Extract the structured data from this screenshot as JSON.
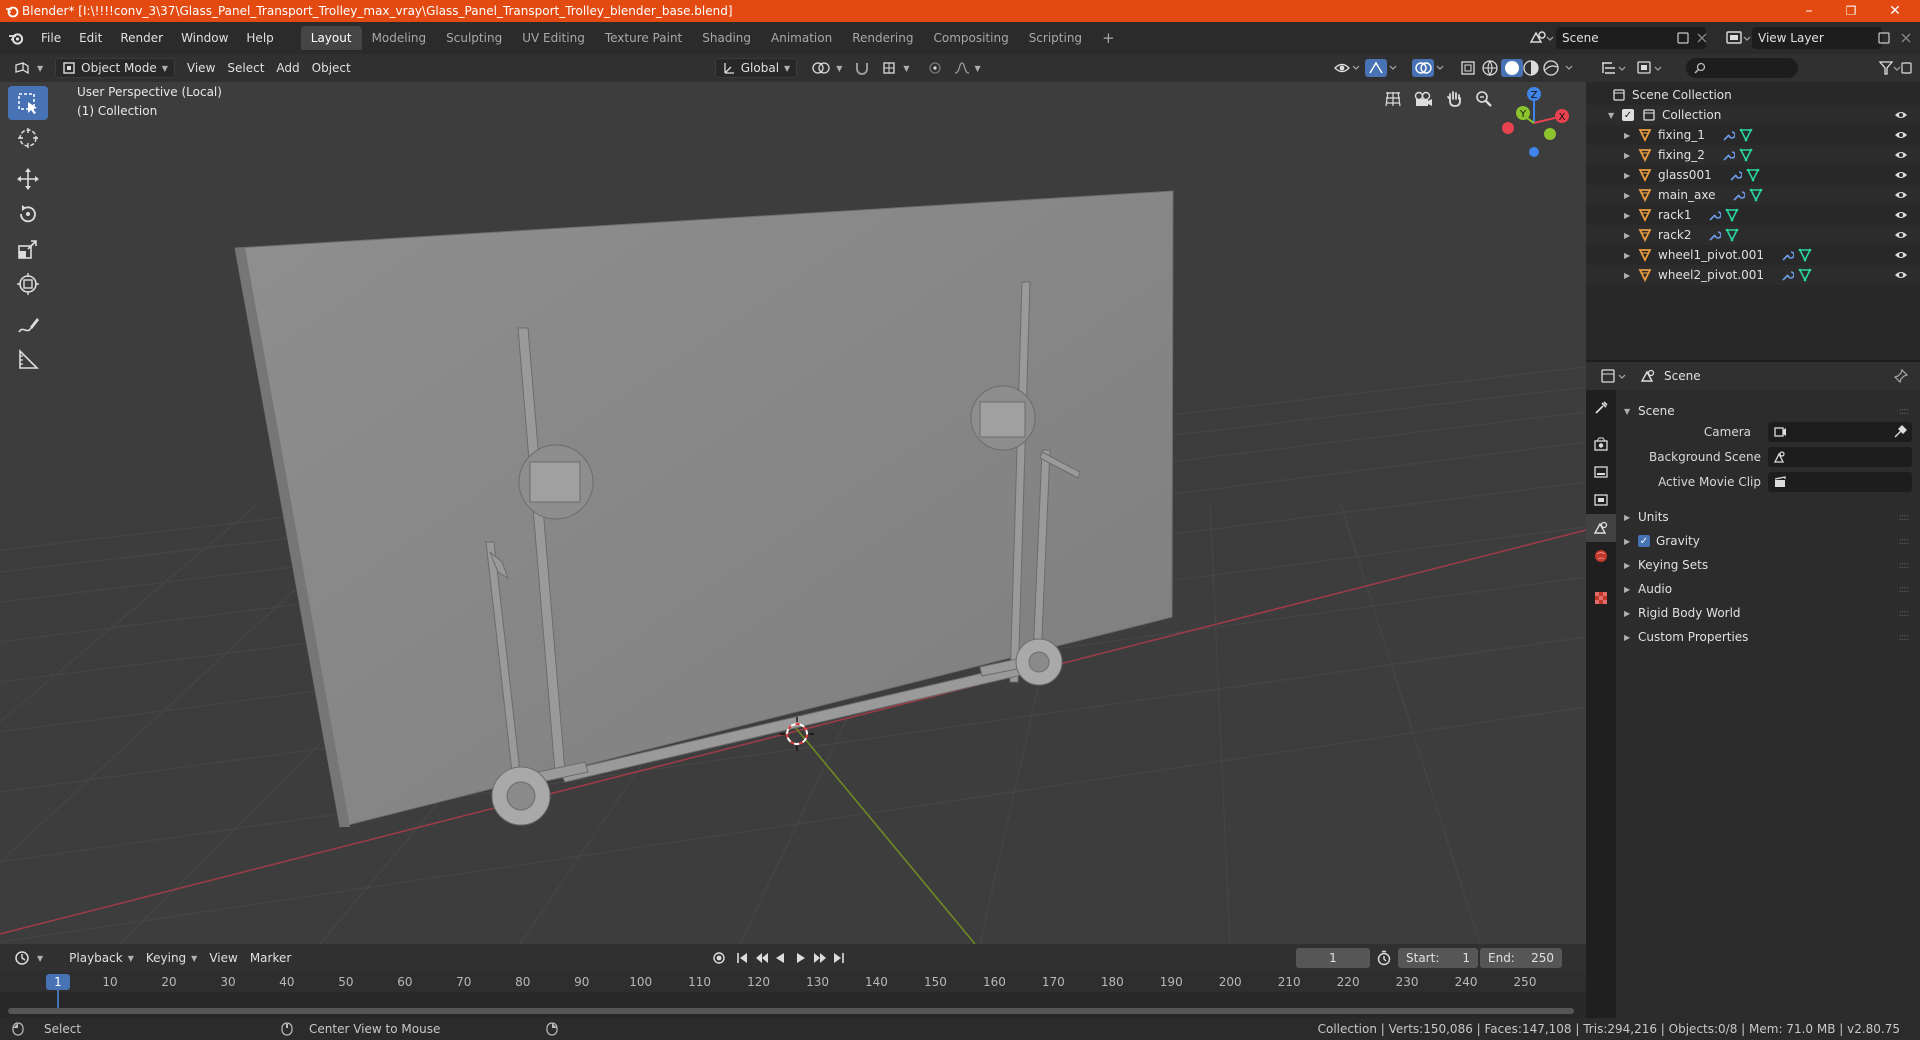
{
  "window": {
    "title": "Blender* [I:\\!!!!conv_3\\37\\Glass_Panel_Transport_Trolley_max_vray\\Glass_Panel_Transport_Trolley_blender_base.blend]",
    "minimize": "–",
    "maximize": "❐",
    "close": "✕"
  },
  "menu": [
    "File",
    "Edit",
    "Render",
    "Window",
    "Help"
  ],
  "workspaces": [
    "Layout",
    "Modeling",
    "Sculpting",
    "UV Editing",
    "Texture Paint",
    "Shading",
    "Animation",
    "Rendering",
    "Compositing",
    "Scripting"
  ],
  "workspace_add": "+",
  "scene_selector": "Scene",
  "view_layer_selector": "View Layer",
  "viewport_header": {
    "mode": "Object Mode",
    "menus": [
      "View",
      "Select",
      "Add",
      "Object"
    ],
    "transform_orientation": "Global"
  },
  "viewport": {
    "perspective_label": "User Perspective (Local)",
    "collection_label": "(1) Collection",
    "gizmo_axes": {
      "x": "X",
      "y": "Y",
      "z": "Z"
    }
  },
  "outliner": {
    "root": "Scene Collection",
    "collection": "Collection",
    "objects": [
      "fixing_1",
      "fixing_2",
      "glass001",
      "main_axe",
      "rack1",
      "rack2",
      "wheel1_pivot.001",
      "wheel2_pivot.001"
    ]
  },
  "properties": {
    "header_title": "Scene",
    "panel_title": "Scene",
    "fields": [
      {
        "label": "Camera"
      },
      {
        "label": "Background Scene"
      },
      {
        "label": "Active Movie Clip"
      }
    ],
    "subpanels": [
      "Units",
      "Gravity",
      "Keying Sets",
      "Audio",
      "Rigid Body World",
      "Custom Properties"
    ],
    "gravity_checked": true
  },
  "timeline": {
    "menus": [
      "Playback",
      "Keying",
      "View",
      "Marker"
    ],
    "current_frame": "1",
    "start_label": "Start:",
    "start": "1",
    "end_label": "End:",
    "end": "250",
    "ruler": [
      "1",
      "10",
      "20",
      "30",
      "40",
      "50",
      "60",
      "70",
      "80",
      "90",
      "100",
      "110",
      "120",
      "130",
      "140",
      "150",
      "160",
      "170",
      "180",
      "190",
      "200",
      "210",
      "220",
      "230",
      "240",
      "250"
    ]
  },
  "statusbar": {
    "left_action": "Select",
    "middle_action": "Center View to Mouse",
    "stats": "Collection | Verts:150,086 | Faces:147,108 | Tris:294,216 | Objects:0/8 | Mem: 71.0 MB | v2.80.75"
  },
  "colors": {
    "titlebar": "#e24a12",
    "accent": "#4772b3",
    "x_axis": "#e8424f",
    "y_axis": "#8bc42c",
    "z_axis": "#3f84e8",
    "object_icon": "#e89a3c",
    "modifier_icon": "#6c9ce8",
    "mesh_icon": "#29d6a0"
  }
}
